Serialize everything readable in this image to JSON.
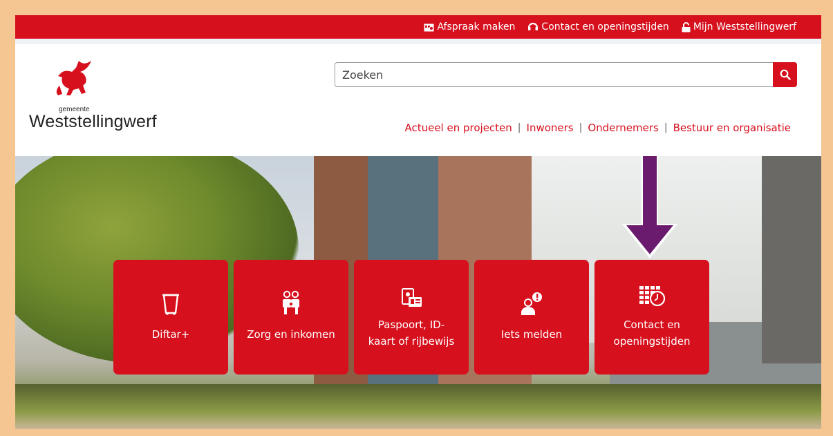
{
  "topbar": {
    "links": [
      {
        "label": "Afspraak maken",
        "icon": "calendar-icon"
      },
      {
        "label": "Contact en openingstijden",
        "icon": "headset-icon"
      },
      {
        "label": "Mijn Weststellingwerf",
        "icon": "lock-icon"
      }
    ]
  },
  "logo": {
    "small": "gemeente",
    "name": "Weststellingwerf"
  },
  "search": {
    "placeholder": "Zoeken"
  },
  "nav": {
    "items": [
      "Actueel en projecten",
      "Inwoners",
      "Ondernemers",
      "Bestuur en organisatie"
    ],
    "separator": "|"
  },
  "tiles": [
    {
      "lines": [
        "Diftar+"
      ],
      "icon": "waste-bin-icon"
    },
    {
      "lines": [
        "Zorg en inkomen"
      ],
      "icon": "people-icon"
    },
    {
      "lines": [
        "Paspoort, ID-",
        "kaart of rijbewijs"
      ],
      "icon": "id-card-icon"
    },
    {
      "lines": [
        "Iets melden"
      ],
      "icon": "report-person-icon"
    },
    {
      "lines": [
        "Contact en",
        "openingstijden"
      ],
      "icon": "schedule-clock-icon"
    }
  ],
  "colors": {
    "brand_red": "#d6101d",
    "border": "#f5c592",
    "arrow": "#6a1b6e"
  }
}
